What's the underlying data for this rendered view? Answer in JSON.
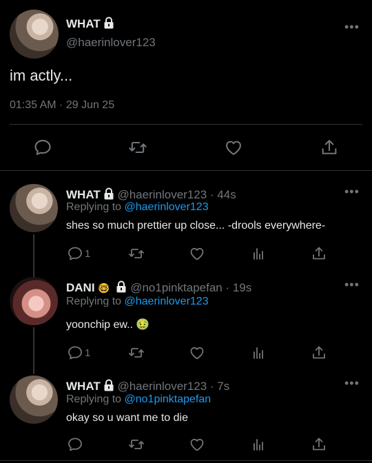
{
  "main_tweet": {
    "name": "WHAT",
    "handle": "@haerinlover123",
    "text": "im actly...",
    "timestamp": "01:35 AM · 29 Jun 25",
    "more": "•••"
  },
  "replies": [
    {
      "name": "WHAT",
      "handle_time": "@haerinlover123 · 44s",
      "replying_prefix": "Replying to",
      "replying_to": "@haerinlover123",
      "text": "shes so much prettier up close... -drools everywhere-",
      "reply_count": "1",
      "more": "•••"
    },
    {
      "name": "DANI",
      "name_emoji": "🤓",
      "handle_time": "@no1pinktapefan · 19s",
      "replying_prefix": "Replying to",
      "replying_to": "@haerinlover123",
      "text": "yoonchip ew.. 🤢",
      "reply_count": "1",
      "more": "•••"
    },
    {
      "name": "WHAT",
      "handle_time": "@haerinlover123 · 7s",
      "replying_prefix": "Replying to",
      "replying_to": "@no1pinktapefan",
      "text": "okay so u want me to die",
      "reply_count": "",
      "more": "•••"
    }
  ],
  "colors": {
    "background": "#000000",
    "text": "#e7e9ea",
    "muted": "#71767b",
    "link": "#1d9bf0",
    "divider": "#2f3336"
  }
}
